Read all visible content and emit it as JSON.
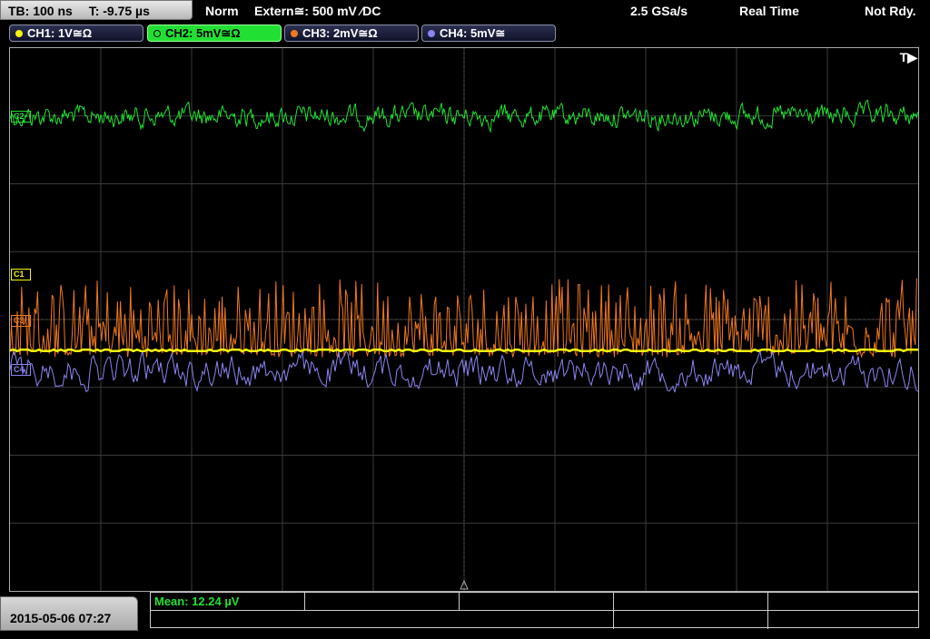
{
  "header": {
    "timebase": "TB: 100 ns",
    "trigger_time": "T: -9.75 µs",
    "trigger_mode": "Norm",
    "trigger_source": "Extern≅: 500 mV ⁄DC",
    "sample_rate": "2.5 GSa/s",
    "acq_mode": "Real Time",
    "status": "Not Rdy."
  },
  "channels": [
    {
      "label": "CH1: 1V≅Ω",
      "color": "#f5f50a"
    },
    {
      "label": "CH2: 5mV≅Ω",
      "color": "#22e033"
    },
    {
      "label": "CH3: 2mV≅Ω",
      "color": "#f07820"
    },
    {
      "label": "CH4: 5mV≅",
      "color": "#8a85f0"
    }
  ],
  "markers": {
    "c1": "C1",
    "c2": "C2",
    "c3": "C3",
    "c4": "C4",
    "trigger": "T▶"
  },
  "measurement": {
    "mean": "Mean: 12.24 µV"
  },
  "datetime": "2015-05-06 07:27"
}
